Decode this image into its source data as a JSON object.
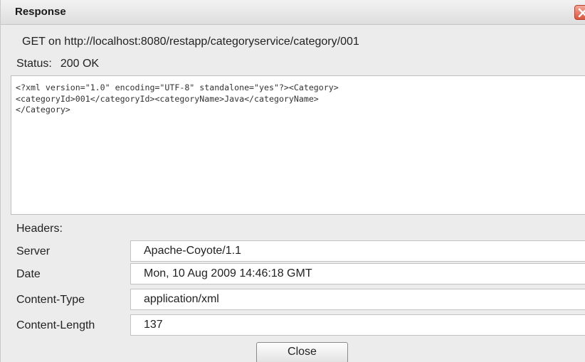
{
  "window": {
    "title": "Response",
    "close_icon": "close-icon"
  },
  "request": {
    "line": "GET on http://localhost:8080/restapp/categoryservice/category/001"
  },
  "status": {
    "label": "Status:",
    "value": "200 OK"
  },
  "response_body": "<?xml version=\"1.0\" encoding=\"UTF-8\" standalone=\"yes\"?><Category>\n<categoryId>001</categoryId><categoryName>Java</categoryName>\n</Category>",
  "headers": {
    "label": "Headers:",
    "rows": [
      {
        "name": "Server",
        "value": "Apache-Coyote/1.1"
      },
      {
        "name": "Date",
        "value": "Mon, 10 Aug 2009 14:46:18 GMT"
      },
      {
        "name": "Content-Type",
        "value": "application/xml"
      },
      {
        "name": "Content-Length",
        "value": "137"
      }
    ]
  },
  "buttons": {
    "close_label": "Close"
  },
  "colors": {
    "close_icon_red": "#d9553e",
    "window_background": "#ececec"
  }
}
